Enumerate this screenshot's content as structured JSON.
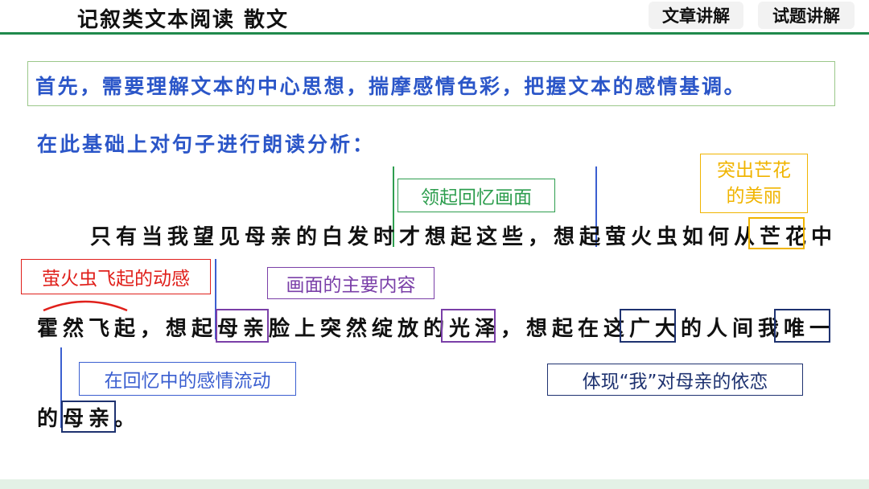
{
  "header": {
    "title": "记叙类文本阅读  散文",
    "tabs": [
      {
        "label": "文章讲解"
      },
      {
        "label": "试题讲解"
      }
    ]
  },
  "intro": "首先，需要理解文本的中心思想，揣摩感情色彩，把握文本的感情基调。",
  "subtitle": "在此基础上对句子进行朗读分析：",
  "passage": {
    "line1": "只有当我望见母亲的白发时才想起这些，想起萤火虫如何从芒花中",
    "line2": "霍然飞起，想起母亲脸上突然绽放的光泽，想起在这广大的人间我唯一",
    "line3": "的母亲。"
  },
  "annotations": {
    "green": "领起回忆画面",
    "orange_line1": "突出芒花",
    "orange_line2": "的美丽",
    "red": "萤火虫飞起的动感",
    "purple": "画面的主要内容",
    "blue_left": "在回忆中的感情流动",
    "navy_right": "体现“我”对母亲的依恋"
  },
  "colors": {
    "accent_green": "#1f8a4c",
    "intro_blue": "#2b56c8",
    "green": "#2e9e4f",
    "orange": "#f0b400",
    "red": "#e0201b",
    "purple": "#7a3fa8",
    "blue": "#3b5fd0",
    "navy": "#1e3270"
  }
}
